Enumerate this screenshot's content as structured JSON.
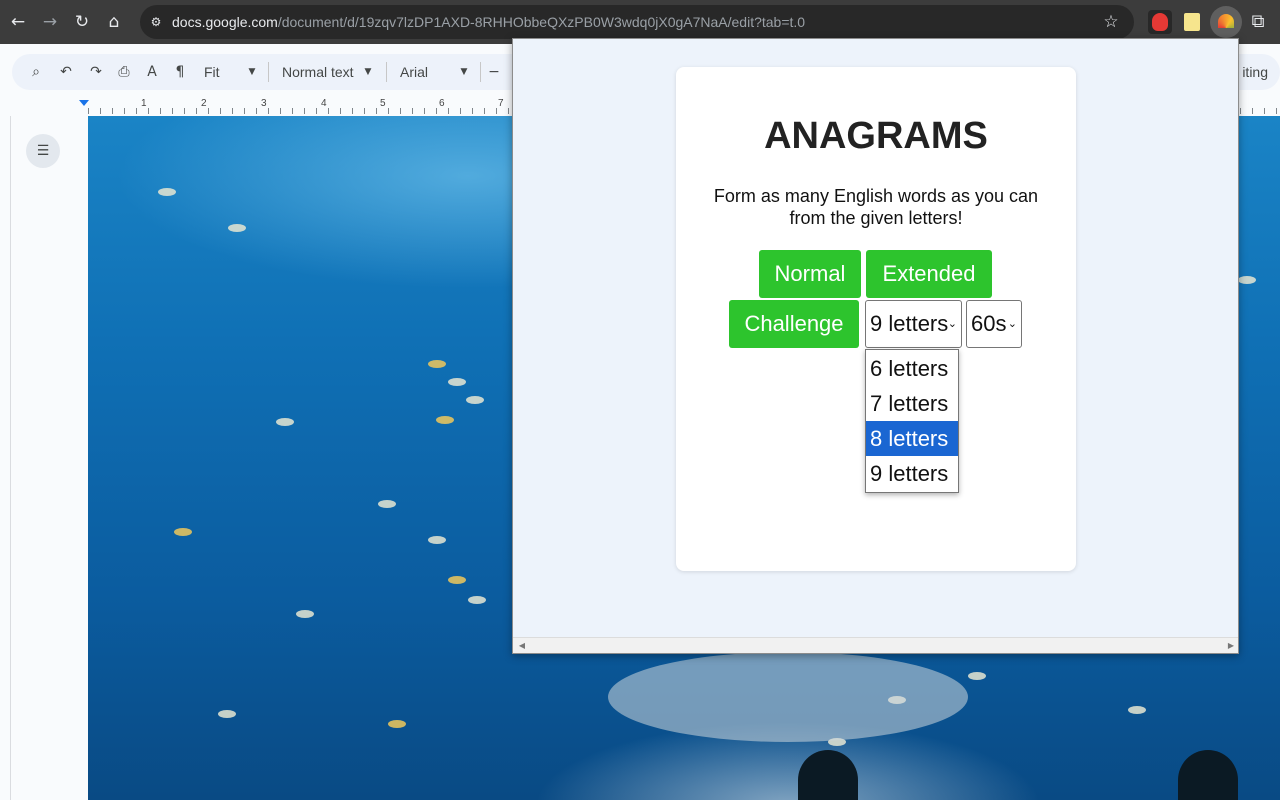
{
  "browser": {
    "url_host": "docs.google.com",
    "url_path": "/document/d/19zqv7lzDP1AXD-8RHHObbeQXzPB0W3wdq0jX0gA7NaA/edit?tab=t.0",
    "icons": [
      "back-icon",
      "forward-icon",
      "reload-icon",
      "home-icon",
      "site-settings-icon",
      "bookmark-star-icon",
      "extensions-puzzle-icon"
    ]
  },
  "docs_toolbar": {
    "zoom": "Fit",
    "style": "Normal text",
    "font": "Arial",
    "mode_partial": "iting"
  },
  "ruler": {
    "numbers": [
      "1",
      "2",
      "3",
      "4",
      "5",
      "6",
      "7"
    ]
  },
  "popup": {
    "title": "ANAGRAMS",
    "subtitle": "Form as many English words as you can from the given letters!",
    "buttons": {
      "normal": "Normal",
      "extended": "Extended",
      "challenge": "Challenge"
    },
    "letters_select": {
      "value": "9 letters",
      "options": [
        "6 letters",
        "7 letters",
        "8 letters",
        "9 letters"
      ],
      "highlighted": "8 letters"
    },
    "time_select": {
      "value": "60s"
    },
    "colors": {
      "button_green": "#2dc42d",
      "highlight_blue": "#1a66d2"
    }
  }
}
